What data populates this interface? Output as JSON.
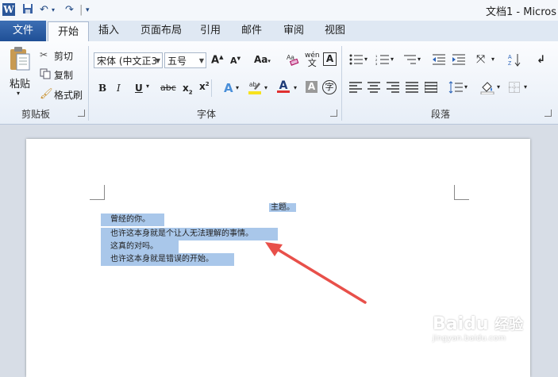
{
  "window": {
    "title": "文档1 - Micros"
  },
  "tabs": [
    "文件",
    "开始",
    "插入",
    "页面布局",
    "引用",
    "邮件",
    "审阅",
    "视图"
  ],
  "ribbon": {
    "clipboard": {
      "group_label": "剪贴板",
      "paste": "粘贴",
      "cut": "剪切",
      "copy": "复制",
      "format_painter": "格式刷"
    },
    "font": {
      "group_label": "字体",
      "font_name": "宋体 (中文正3",
      "font_size": "五号",
      "aa_label": "Aa",
      "phonetic": "wén",
      "enclose_char": "字"
    },
    "paragraph": {
      "group_label": "段落"
    }
  },
  "document": {
    "lines": [
      "主题。",
      "曾经的你。",
      "也许这本身就是个让人无法理解的事情。",
      "这真的对吗。",
      "也许这本身就是错误的开始。"
    ]
  },
  "colors": {
    "selection": "#a9c7ea",
    "arrow": "#e8504a",
    "font_color_bar": "#e03030",
    "highlight_bar": "#f7e21f"
  },
  "watermark": {
    "brand": "Baidu",
    "cn": "经验",
    "url": "jingyan.baidu.com"
  }
}
